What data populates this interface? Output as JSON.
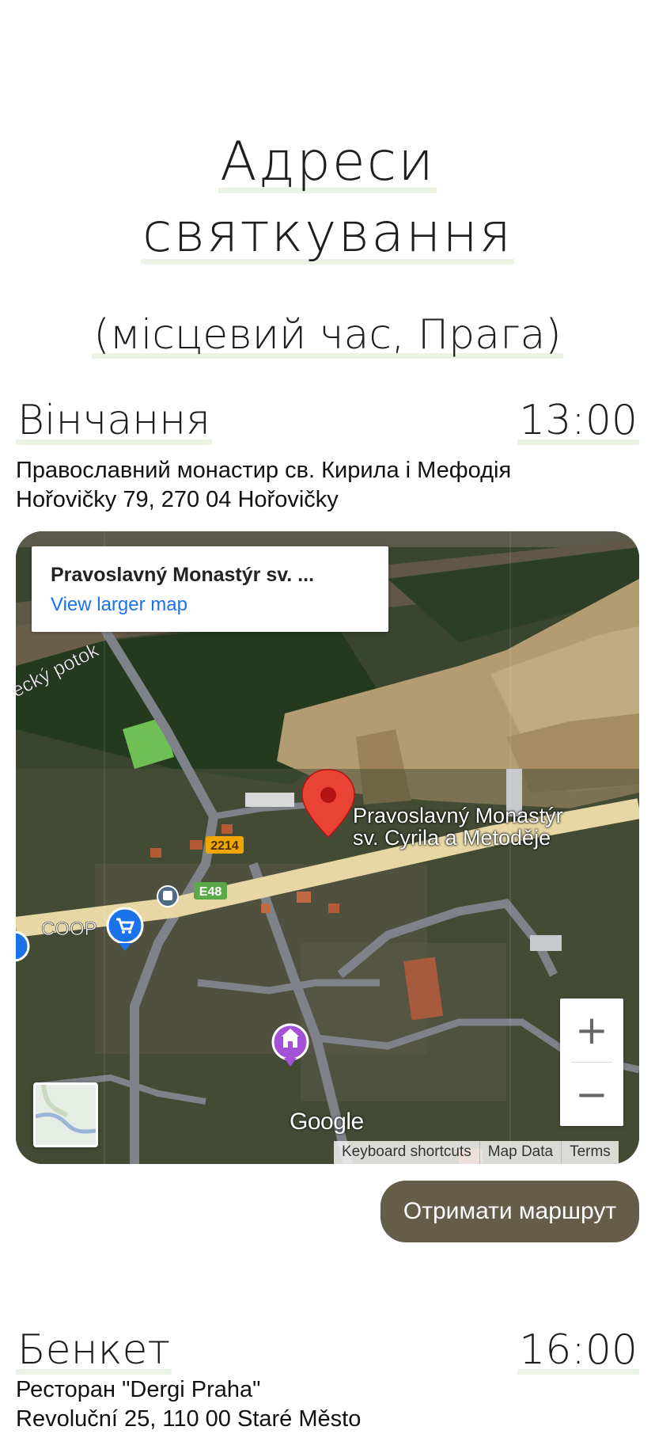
{
  "page": {
    "title_line1": "Адреси",
    "title_line2": "святкування",
    "subtitle": "(місцевий час, Прага)"
  },
  "events": [
    {
      "name": "Вінчання",
      "time": "13:00",
      "venue": "Православний монастир св. Кирила і Мефодія",
      "address": "Hořovičky 79, 270 04 Hořovičky"
    },
    {
      "name": "Бенкет",
      "time": "16:00",
      "venue": "Ресторан \"Dergi Praha\"",
      "address": "Revoluční 25, 110 00 Staré Město"
    }
  ],
  "map": {
    "info_title": "Pravoslavný Monastýr sv. ...",
    "info_link": "View larger map",
    "pin_label_line1": "Pravoslavný Monastýr",
    "pin_label_line2": "sv. Cyrila a Metoděje",
    "stream_label": "ecký potok",
    "road_2214": "2214",
    "road_e48": "E48",
    "shop_label": "COOP",
    "zoom_in": "+",
    "zoom_out": "−",
    "google_logo": "Google",
    "attrib_keyboard": "Keyboard shortcuts",
    "attrib_map_data": "Map Data",
    "attrib_terms": "Terms"
  },
  "route_button": "Отримати маршрут",
  "colors": {
    "accent_button": "#655d4a",
    "highlight": "#eaf3e4",
    "link": "#1a73e8",
    "pin": "#ea4335"
  }
}
